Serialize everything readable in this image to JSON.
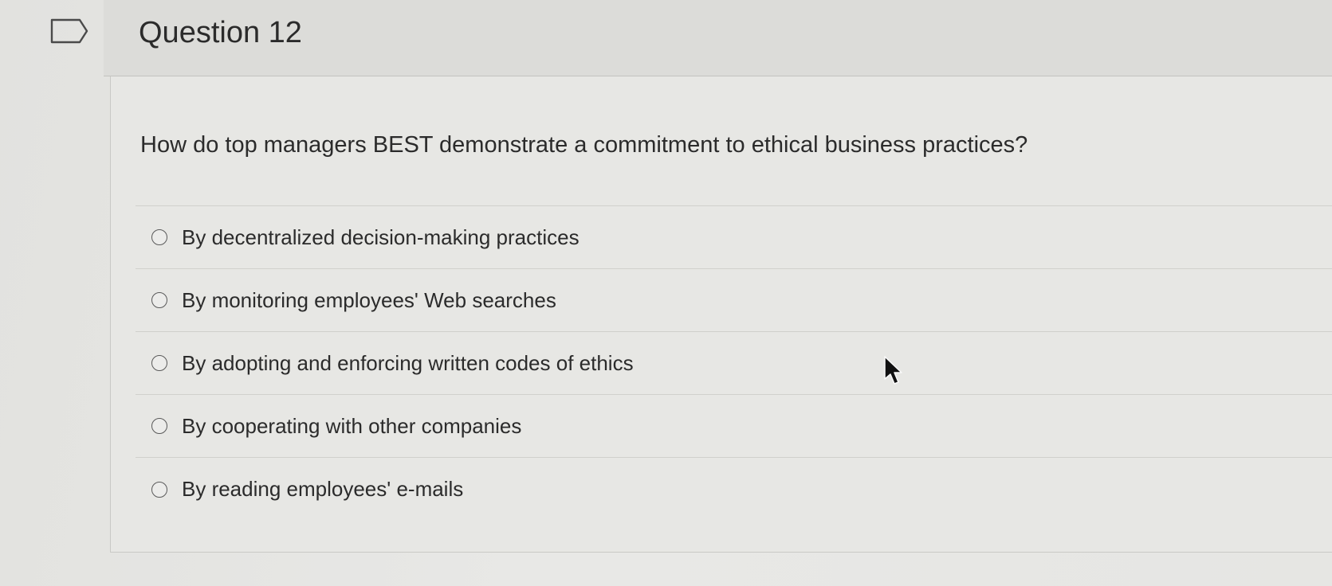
{
  "question": {
    "title": "Question 12",
    "prompt": "How do top managers BEST demonstrate a commitment to ethical business practices?"
  },
  "answers": [
    {
      "label": "By decentralized decision-making practices",
      "selected": false
    },
    {
      "label": "By monitoring employees' Web searches",
      "selected": false
    },
    {
      "label": "By adopting and enforcing written codes of ethics",
      "selected": false
    },
    {
      "label": "By cooperating with other companies",
      "selected": false
    },
    {
      "label": "By reading employees' e-mails",
      "selected": false
    }
  ],
  "icons": {
    "flag": "flag-question-icon",
    "radio": "radio-unselected-icon",
    "cursor": "mouse-pointer-icon"
  }
}
